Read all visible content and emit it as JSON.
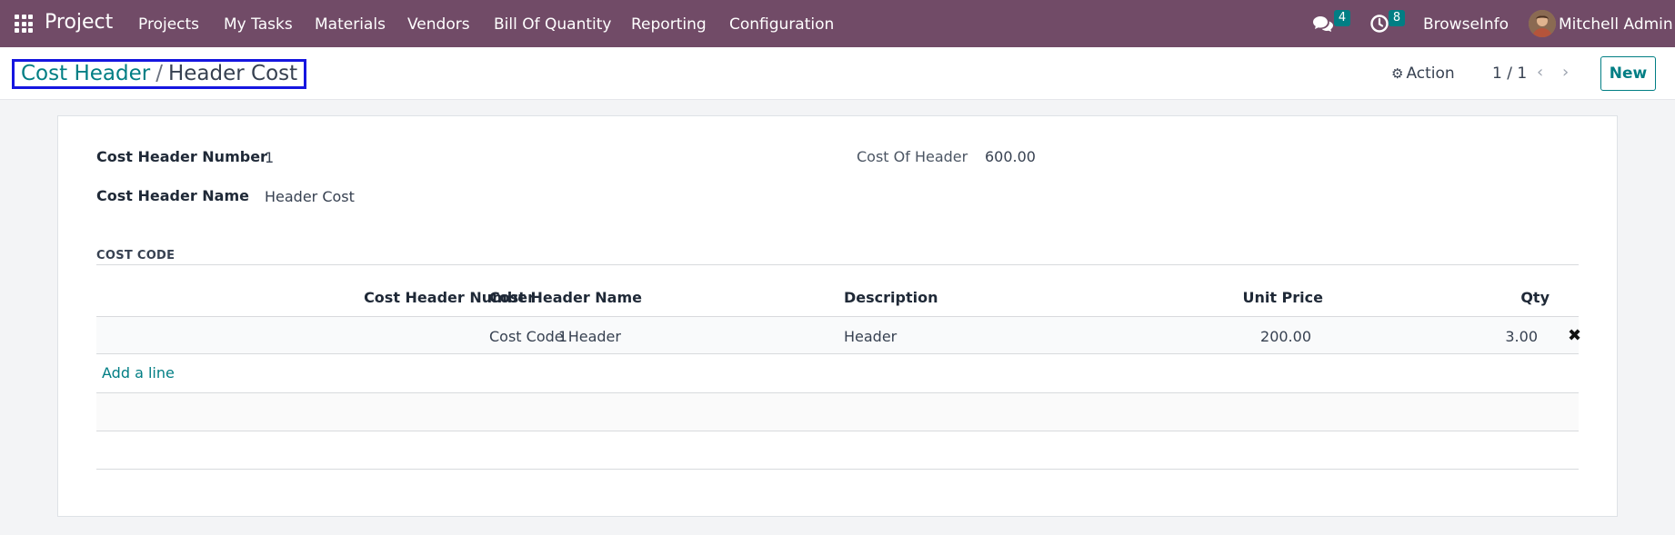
{
  "nav": {
    "brand": "Project",
    "menu": [
      "Projects",
      "My Tasks",
      "Materials",
      "Vendors",
      "Bill Of Quantity",
      "Reporting",
      "Configuration"
    ],
    "messages_count": "4",
    "activities_count": "8",
    "company": "BrowseInfo",
    "user": "Mitchell Admin"
  },
  "control": {
    "breadcrumb_parent": "Cost Header",
    "breadcrumb_sep": "/",
    "breadcrumb_current": "Header Cost",
    "action_label": "Action",
    "pager": "1 / 1",
    "new_label": "New"
  },
  "form": {
    "fields": {
      "number_label": "Cost Header Number",
      "number_value": "1",
      "name_label": "Cost Header Name",
      "name_value": "Header Cost",
      "cost_label": "Cost Of Header",
      "cost_value": "600.00"
    },
    "section_title": "COST CODE",
    "columns": [
      "Cost Header Number",
      "Cost Header Name",
      "Description",
      "Unit Price",
      "Qty"
    ],
    "rows": [
      {
        "number": "1",
        "name": "Cost Code Header",
        "description": "Header",
        "unit_price": "200.00",
        "qty": "3.00"
      }
    ],
    "add_line": "Add a line"
  }
}
